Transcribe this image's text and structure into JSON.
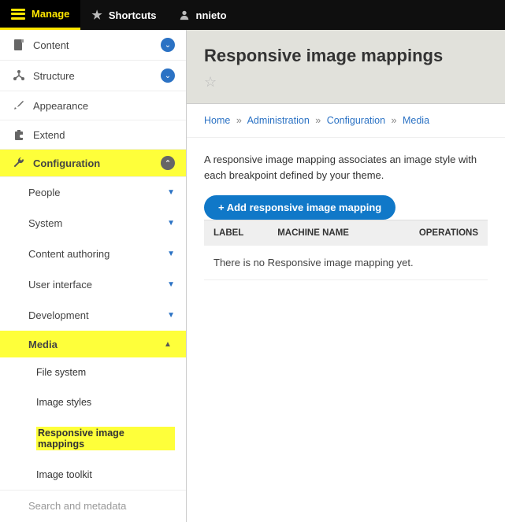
{
  "topbar": {
    "manage": "Manage",
    "shortcuts": "Shortcuts",
    "user": "nnieto"
  },
  "sidebar": {
    "content": "Content",
    "structure": "Structure",
    "appearance": "Appearance",
    "extend": "Extend",
    "configuration": "Configuration",
    "config_children": {
      "people": "People",
      "system": "System",
      "content_authoring": "Content authoring",
      "user_interface": "User interface",
      "development": "Development",
      "media": "Media",
      "media_children": {
        "file_system": "File system",
        "image_styles": "Image styles",
        "responsive_image_mappings": "Responsive image mappings",
        "image_toolkit": "Image toolkit"
      },
      "search_metadata": "Search and metadata"
    }
  },
  "page": {
    "title": "Responsive image mappings",
    "breadcrumbs": {
      "home": "Home",
      "administration": "Administration",
      "configuration": "Configuration",
      "media": "Media"
    },
    "description": "A responsive image mapping associates an image style with each breakpoint defined by your theme.",
    "add_button": "+ Add responsive image mapping",
    "table": {
      "headers": {
        "label": "LABEL",
        "machine_name": "MACHINE NAME",
        "operations": "OPERATIONS"
      },
      "empty": "There is no Responsive image mapping yet."
    }
  }
}
